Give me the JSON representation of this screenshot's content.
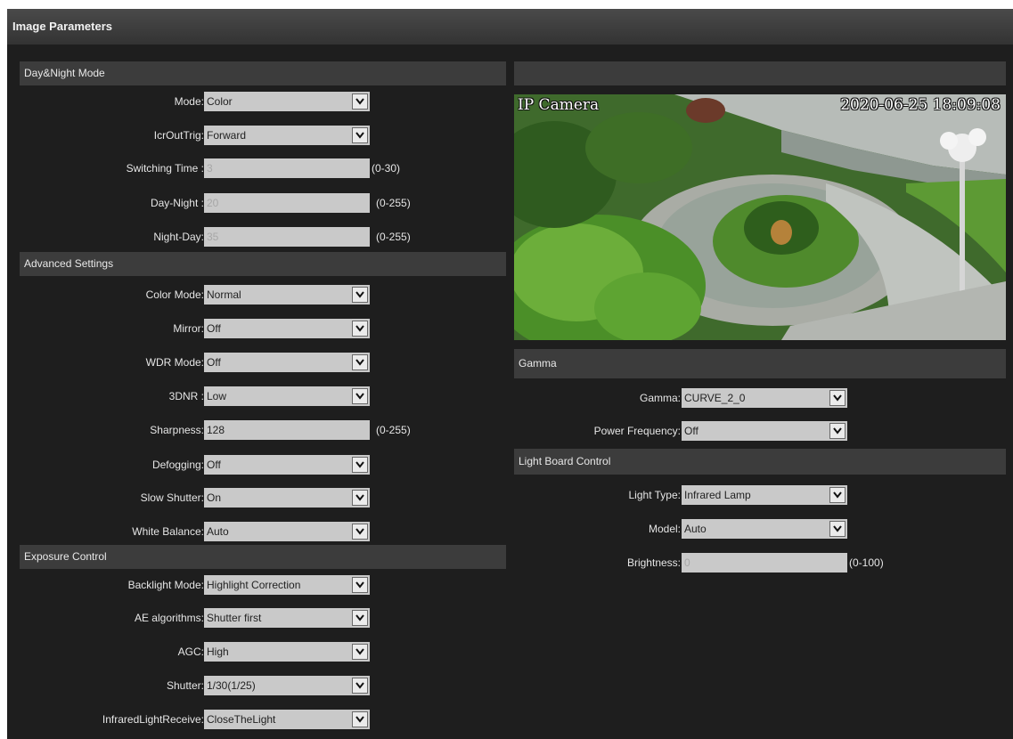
{
  "header": {
    "title": "Image Parameters"
  },
  "sections": {
    "day_night": "Day&Night Mode",
    "advanced": "Advanced Settings",
    "exposure": "Exposure Control",
    "gamma": "Gamma",
    "light_board": "Light Board Control"
  },
  "fields": {
    "mode": {
      "label": "Mode:",
      "value": "Color"
    },
    "icrouttrig": {
      "label": "IcrOutTrig:",
      "value": "Forward"
    },
    "switching_time": {
      "label": "Switching Time :",
      "value": "3",
      "range": "(0-30)"
    },
    "day_night": {
      "label": "Day-Night :",
      "value": "20",
      "range": "(0-255)"
    },
    "night_day": {
      "label": "Night-Day:",
      "value": "35",
      "range": "(0-255)"
    },
    "color_mode": {
      "label": "Color Mode:",
      "value": "Normal"
    },
    "mirror": {
      "label": "Mirror:",
      "value": "Off"
    },
    "wdr_mode": {
      "label": "WDR Mode:",
      "value": "Off"
    },
    "3dnr": {
      "label": "3DNR :",
      "value": "Low"
    },
    "sharpness": {
      "label": "Sharpness:",
      "value": "128",
      "range": "(0-255)"
    },
    "defogging": {
      "label": "Defogging:",
      "value": "Off"
    },
    "slow_shutter": {
      "label": "Slow Shutter:",
      "value": "On"
    },
    "white_balance": {
      "label": "White Balance:",
      "value": "Auto"
    },
    "backlight_mode": {
      "label": "Backlight Mode:",
      "value": "Highlight Correction"
    },
    "ae_algorithms": {
      "label": "AE algorithms:",
      "value": "Shutter first"
    },
    "agc": {
      "label": "AGC:",
      "value": "High"
    },
    "shutter": {
      "label": "Shutter:",
      "value": "1/30(1/25)"
    },
    "infrared_light_receive": {
      "label": "InfraredLightReceive:",
      "value": "CloseTheLight"
    },
    "gamma": {
      "label": "Gamma:",
      "value": "CURVE_2_0"
    },
    "power_frequency": {
      "label": "Power Frequency:",
      "value": "Off"
    },
    "light_type": {
      "label": "Light Type:",
      "value": "Infrared Lamp"
    },
    "model": {
      "label": "Model:",
      "value": "Auto"
    },
    "brightness": {
      "label": "Brightness:",
      "value": "0",
      "range": "(0-100)"
    }
  },
  "preview": {
    "osd_name": "IP Camera",
    "osd_timestamp": "2020-06-25 18:09:08"
  },
  "icons": {
    "dropdown": "chevron-down-icon"
  },
  "colors": {
    "panel_bg": "#1e1e1e",
    "section_bg": "#3c3c3c",
    "field_bg": "#c9c9c9",
    "label_text": "#e6e6e6"
  }
}
